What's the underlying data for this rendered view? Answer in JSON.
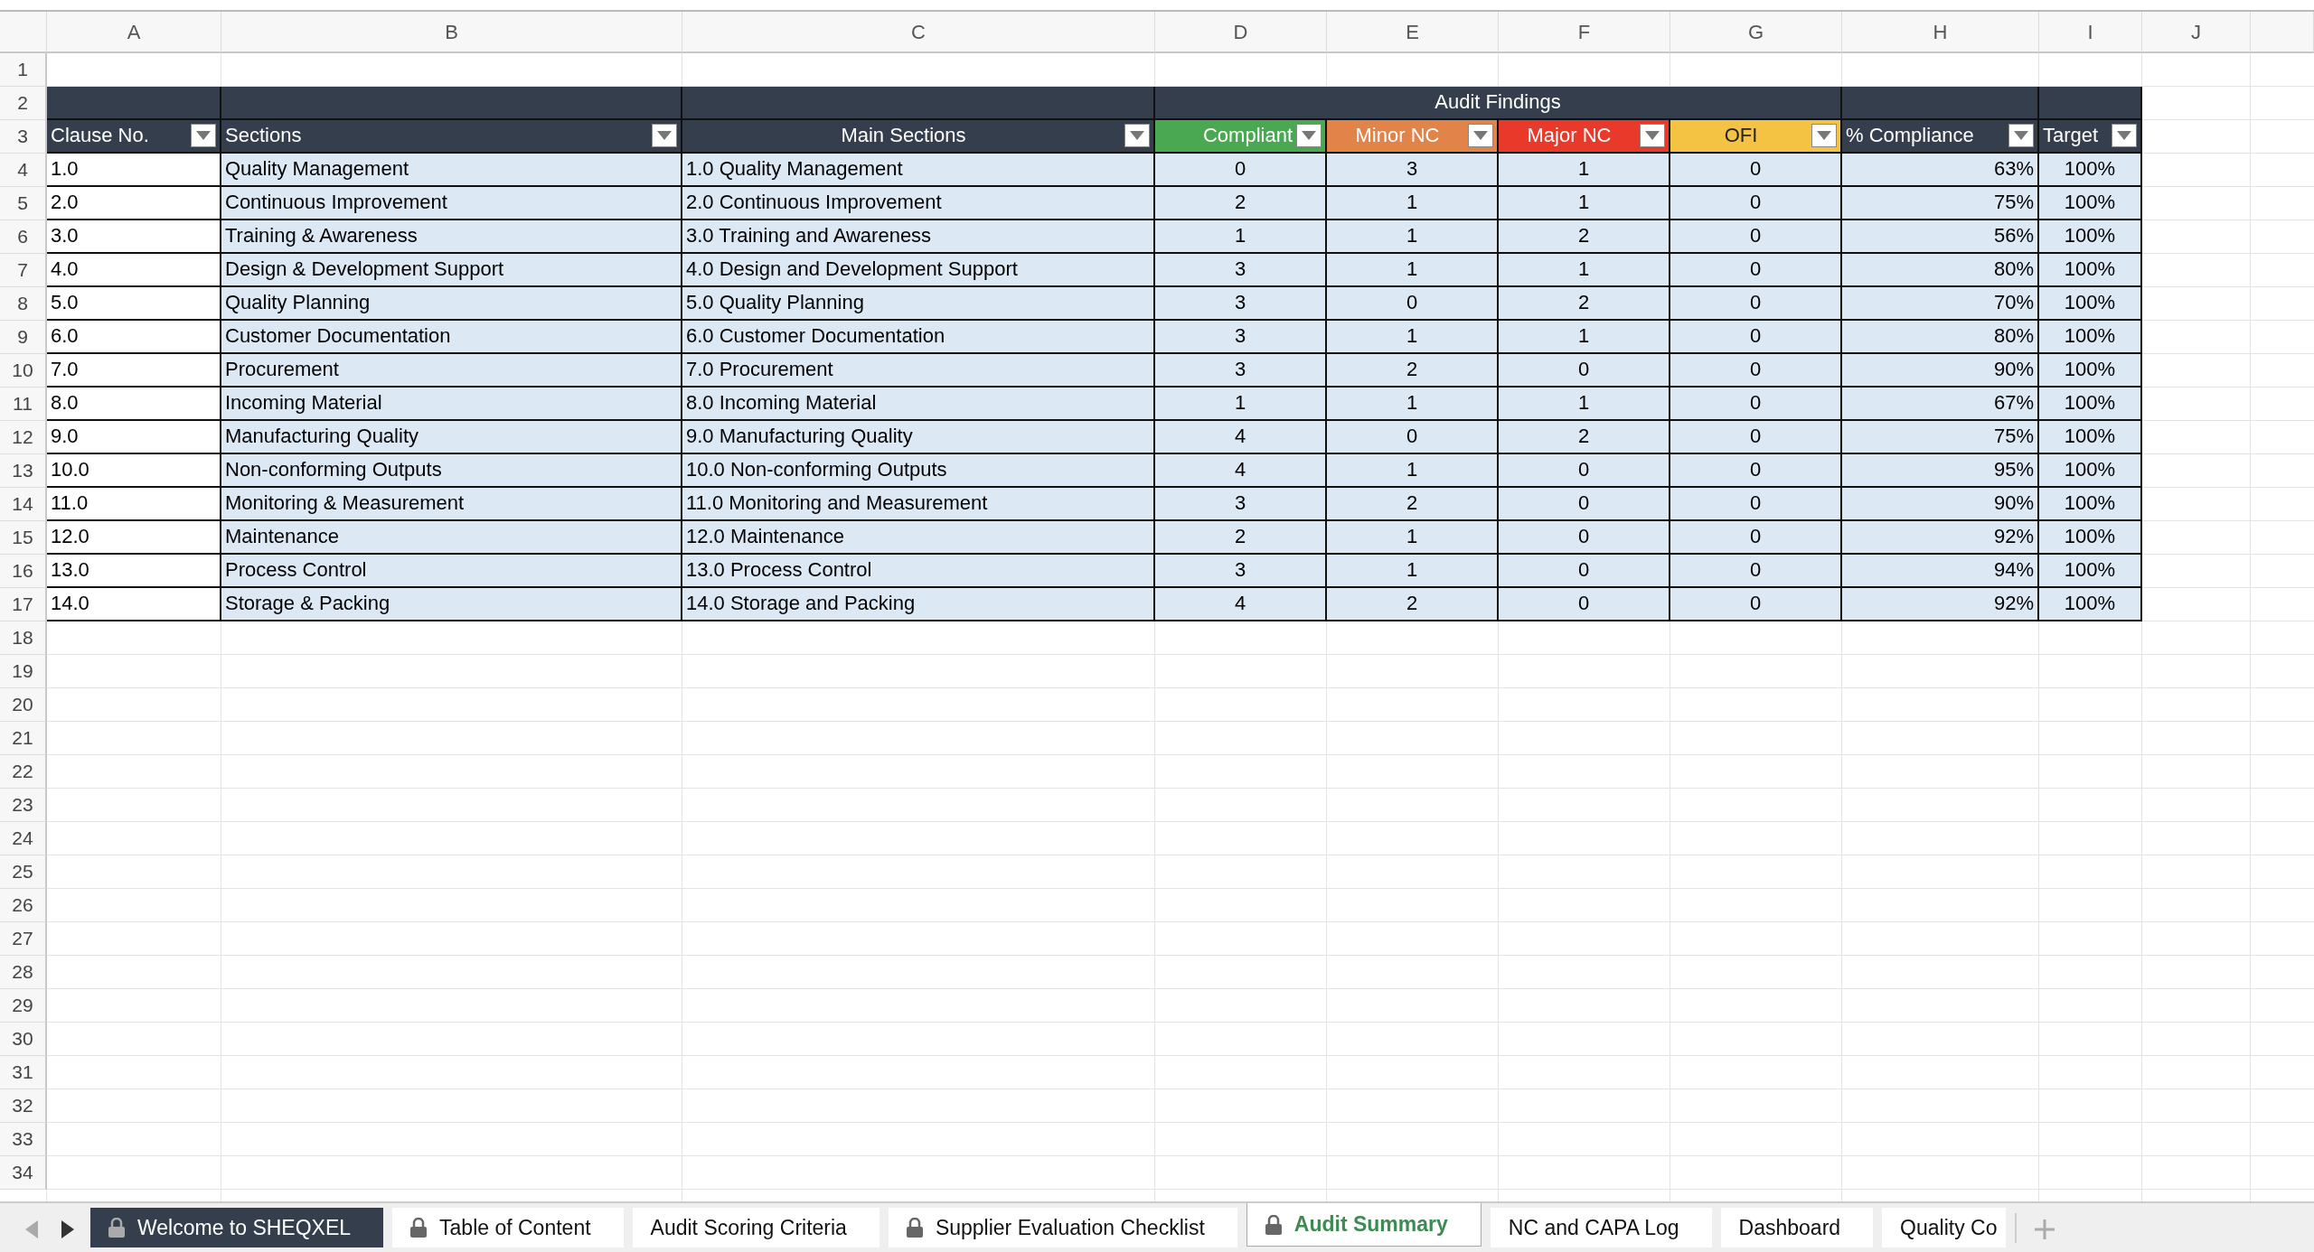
{
  "columns": [
    "A",
    "B",
    "C",
    "D",
    "E",
    "F",
    "G",
    "H",
    "I",
    "J"
  ],
  "row_numbers": [
    "1",
    "2",
    "3",
    "4",
    "5",
    "6",
    "7",
    "8",
    "9",
    "10",
    "11",
    "12",
    "13",
    "14",
    "15",
    "16",
    "17",
    "18",
    "19",
    "20",
    "21",
    "22",
    "23",
    "24",
    "25",
    "26",
    "27",
    "28",
    "29",
    "30",
    "31",
    "32",
    "33",
    "34"
  ],
  "group_header": {
    "label": "Audit Findings"
  },
  "headers": [
    {
      "label": "Clause No.",
      "color": "#343e4d"
    },
    {
      "label": "Sections",
      "color": "#343e4d"
    },
    {
      "label": "Main Sections",
      "color": "#343e4d"
    },
    {
      "label": "Compliant",
      "color": "#4aa853"
    },
    {
      "label": "Minor NC",
      "color": "#e2834a"
    },
    {
      "label": "Major NC",
      "color": "#e8392a"
    },
    {
      "label": "OFI",
      "color": "#f5c344"
    },
    {
      "label": "% Compliance",
      "color": "#343e4d"
    },
    {
      "label": "Target",
      "color": "#343e4d"
    }
  ],
  "rows": [
    [
      "1.0",
      "Quality Management",
      "1.0 Quality Management",
      "0",
      "3",
      "1",
      "0",
      "63%",
      "100%"
    ],
    [
      "2.0",
      "Continuous Improvement",
      "2.0 Continuous Improvement",
      "2",
      "1",
      "1",
      "0",
      "75%",
      "100%"
    ],
    [
      "3.0",
      "Training & Awareness",
      "3.0 Training and Awareness",
      "1",
      "1",
      "2",
      "0",
      "56%",
      "100%"
    ],
    [
      "4.0",
      "Design & Development Support",
      "4.0 Design and Development Support",
      "3",
      "1",
      "1",
      "0",
      "80%",
      "100%"
    ],
    [
      "5.0",
      "Quality Planning",
      "5.0 Quality Planning",
      "3",
      "0",
      "2",
      "0",
      "70%",
      "100%"
    ],
    [
      "6.0",
      "Customer Documentation",
      "6.0 Customer Documentation",
      "3",
      "1",
      "1",
      "0",
      "80%",
      "100%"
    ],
    [
      "7.0",
      "Procurement",
      "7.0 Procurement",
      "3",
      "2",
      "0",
      "0",
      "90%",
      "100%"
    ],
    [
      "8.0",
      "Incoming Material",
      "8.0 Incoming Material",
      "1",
      "1",
      "1",
      "0",
      "67%",
      "100%"
    ],
    [
      "9.0",
      "Manufacturing Quality",
      "9.0 Manufacturing Quality",
      "4",
      "0",
      "2",
      "0",
      "75%",
      "100%"
    ],
    [
      "10.0",
      "Non-conforming Outputs",
      "10.0 Non-conforming Outputs",
      "4",
      "1",
      "0",
      "0",
      "95%",
      "100%"
    ],
    [
      "11.0",
      "Monitoring & Measurement",
      "11.0 Monitoring and Measurement",
      "3",
      "2",
      "0",
      "0",
      "90%",
      "100%"
    ],
    [
      "12.0",
      "Maintenance",
      "12.0 Maintenance",
      "2",
      "1",
      "0",
      "0",
      "92%",
      "100%"
    ],
    [
      "13.0",
      "Process Control",
      "13.0 Process Control",
      "3",
      "1",
      "0",
      "0",
      "94%",
      "100%"
    ],
    [
      "14.0",
      "Storage & Packing",
      "14.0 Storage and Packing",
      "4",
      "2",
      "0",
      "0",
      "92%",
      "100%"
    ]
  ],
  "sheet_tabs": [
    {
      "label": "Welcome to SHEQXEL",
      "locked": true,
      "selected": false,
      "colored": true
    },
    {
      "label": "Table of Content",
      "locked": true,
      "selected": false,
      "colored": false
    },
    {
      "label": "Audit Scoring Criteria",
      "locked": false,
      "selected": false,
      "colored": false
    },
    {
      "label": "Supplier Evaluation Checklist",
      "locked": true,
      "selected": false,
      "colored": false
    },
    {
      "label": "Audit Summary",
      "locked": true,
      "selected": true,
      "colored": false
    },
    {
      "label": "NC and CAPA Log",
      "locked": false,
      "selected": false,
      "colored": false
    },
    {
      "label": "Dashboard",
      "locked": false,
      "selected": false,
      "colored": false
    },
    {
      "label": "Quality Co",
      "locked": false,
      "selected": false,
      "colored": false
    }
  ]
}
